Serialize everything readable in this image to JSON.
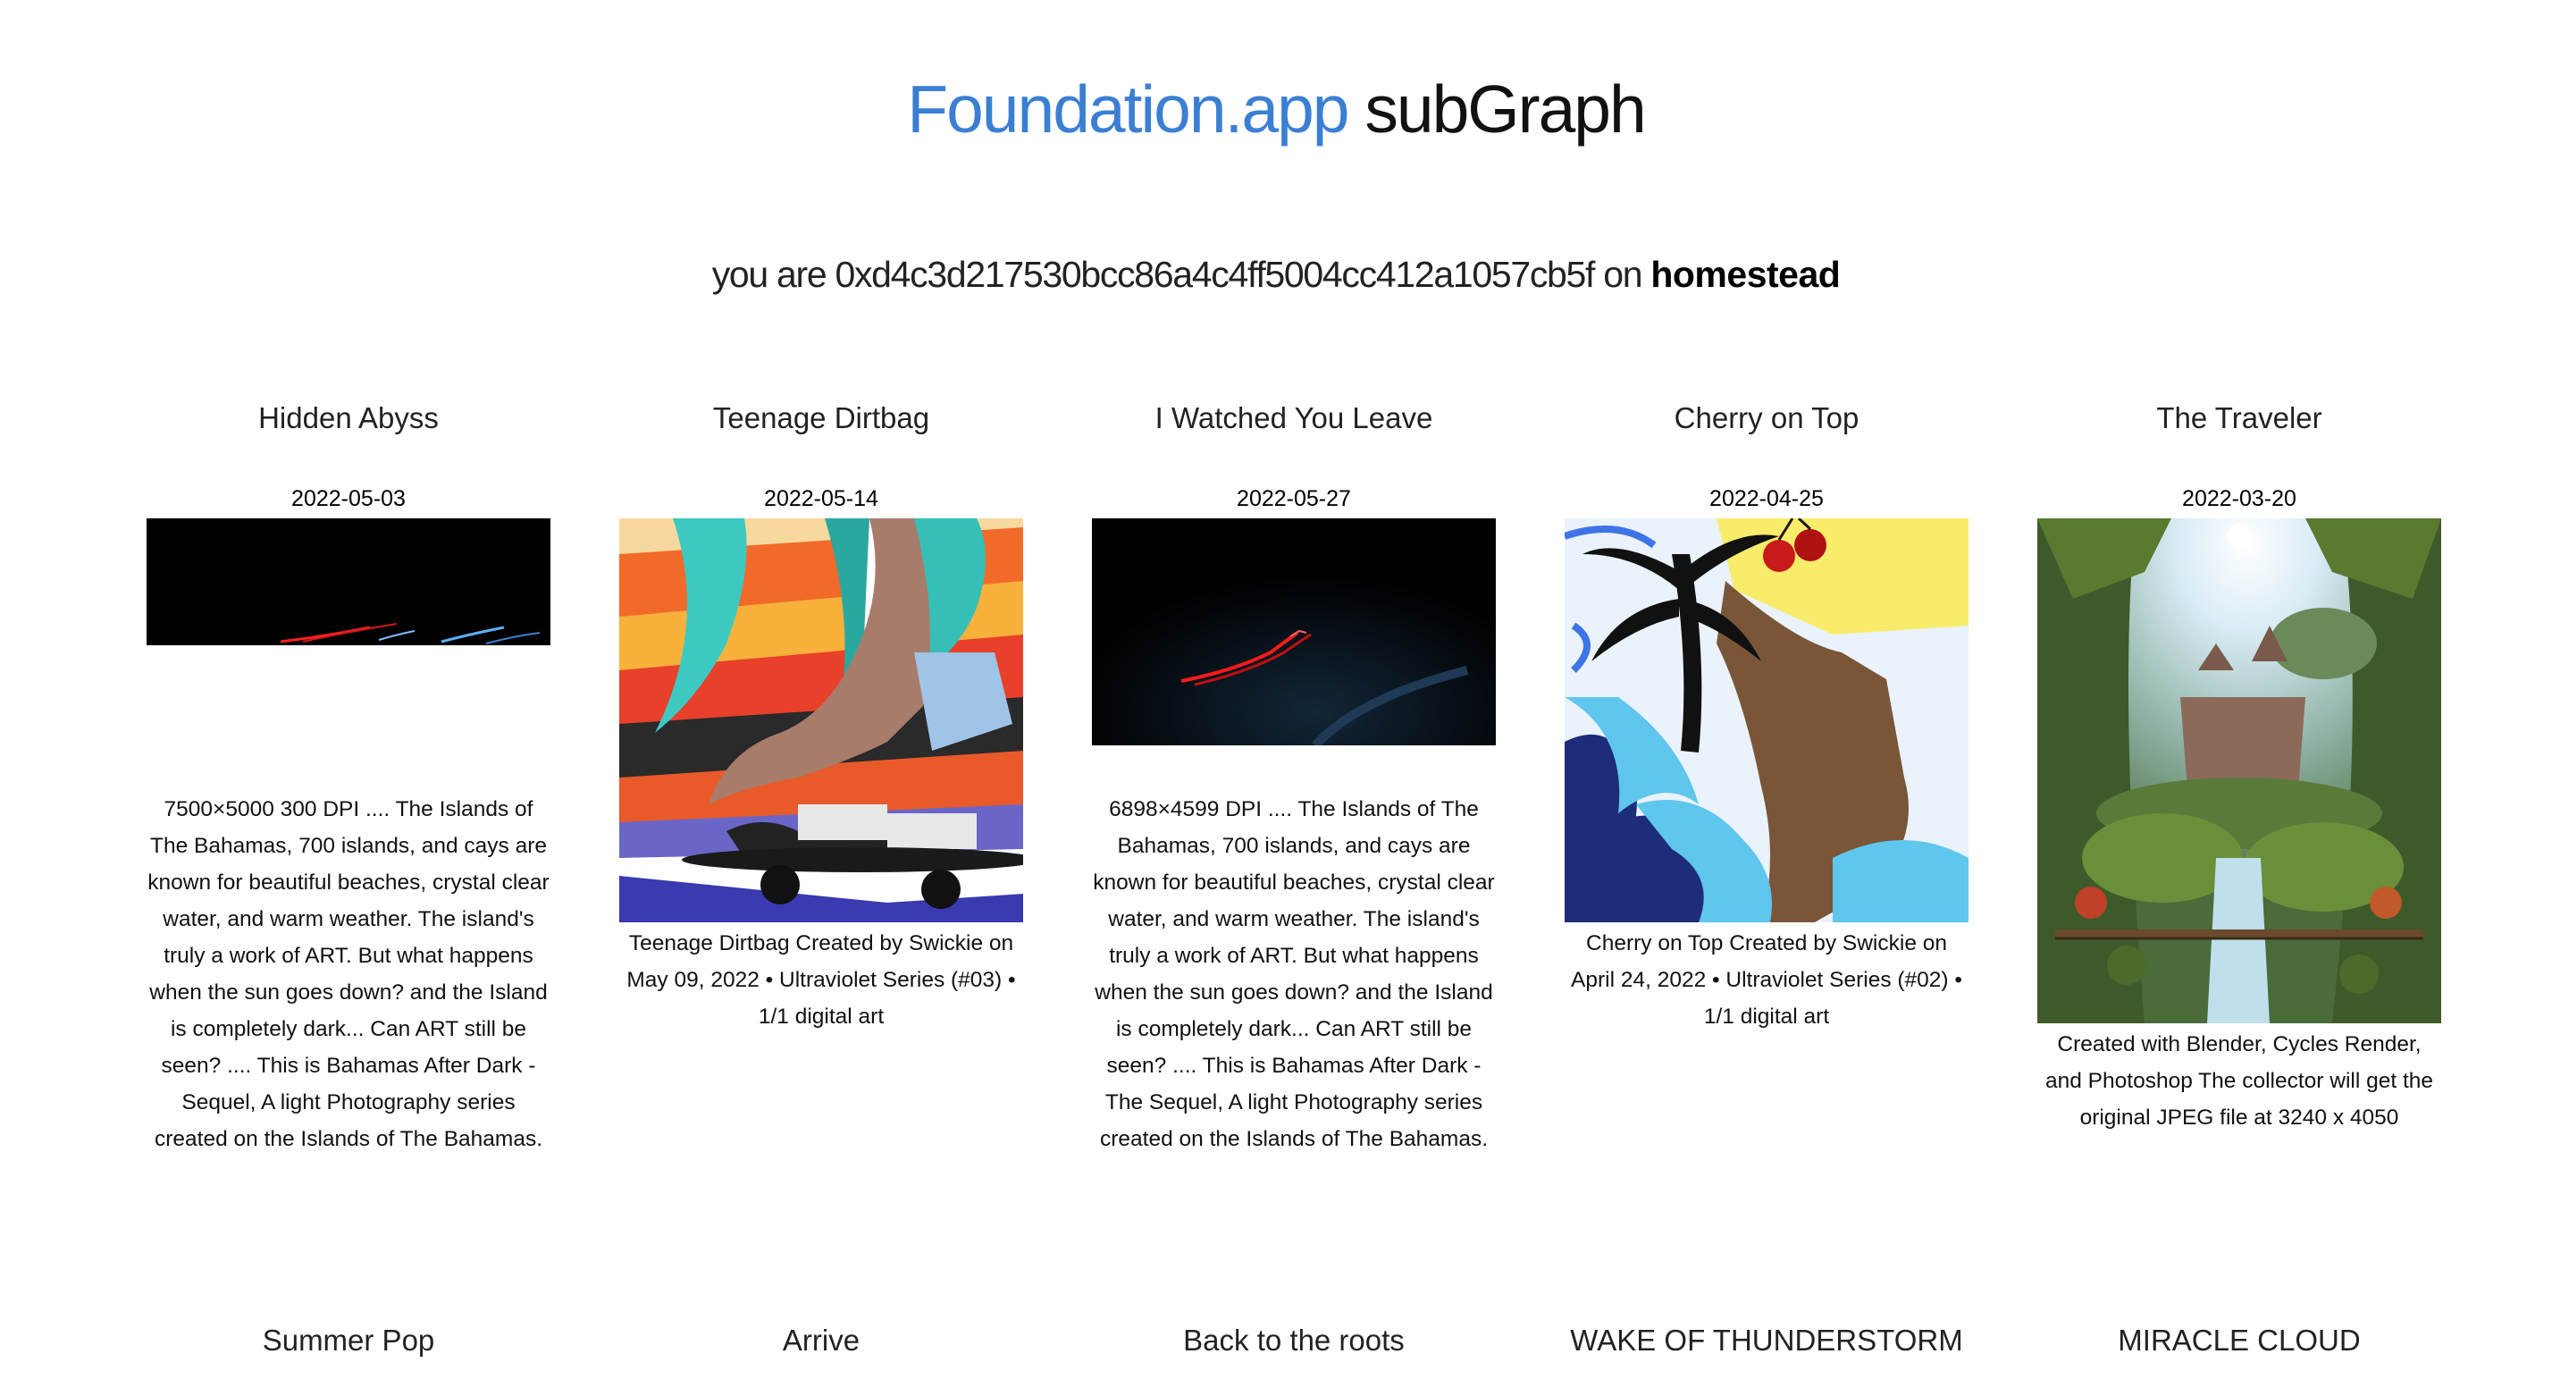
{
  "header": {
    "brand": "Foundation.app",
    "rest": "subGraph"
  },
  "account": {
    "prefix": "you are",
    "address": "0xd4c3d217530bcc86a4c4ff5004cc412a1057cb5f",
    "on_word": "on",
    "network": "homestead"
  },
  "cards": [
    {
      "title": "Hidden Abyss",
      "date": "2022-05-03",
      "description": "7500×5000 300 DPI .... The Islands of The Bahamas, 700 islands, and cays are known for beautiful beaches, crystal clear water, and warm weather. The island's truly a work of ART. But what happens when the sun goes down? and the Island is completely dark... Can ART still be seen? .... This is Bahamas After Dark - Sequel, A light Photography series created on the Islands of The Bahamas."
    },
    {
      "title": "Teenage Dirtbag",
      "date": "2022-05-14",
      "description": "Teenage Dirtbag Created by Swickie on May 09, 2022 • Ultraviolet Series (#03) • 1/1 digital art"
    },
    {
      "title": "I Watched You Leave",
      "date": "2022-05-27",
      "description": "6898×4599 DPI .... The Islands of The Bahamas, 700 islands, and cays are known for beautiful beaches, crystal clear water, and warm weather. The island's truly a work of ART. But what happens when the sun goes down? and the Island is completely dark... Can ART still be seen? .... This is Bahamas After Dark - The Sequel, A light Photography series created on the Islands of The Bahamas."
    },
    {
      "title": "Cherry on Top",
      "date": "2022-04-25",
      "description": "Cherry on Top Created by Swickie on April 24, 2022 • Ultraviolet Series (#02) • 1/1 digital art"
    },
    {
      "title": "The Traveler",
      "date": "2022-03-20",
      "description": "Created with Blender, Cycles Render, and Photoshop The collector will get the original JPEG file at 3240 x 4050"
    }
  ],
  "next_row": [
    {
      "title": "Summer Pop"
    },
    {
      "title": "Arrive"
    },
    {
      "title": "Back to the roots"
    },
    {
      "title": "WAKE OF THUNDERSTORM"
    },
    {
      "title": "MIRACLE CLOUD"
    }
  ],
  "colors": {
    "brand_blue": "#3b7fd4",
    "text": "#111111",
    "background": "#ffffff"
  }
}
